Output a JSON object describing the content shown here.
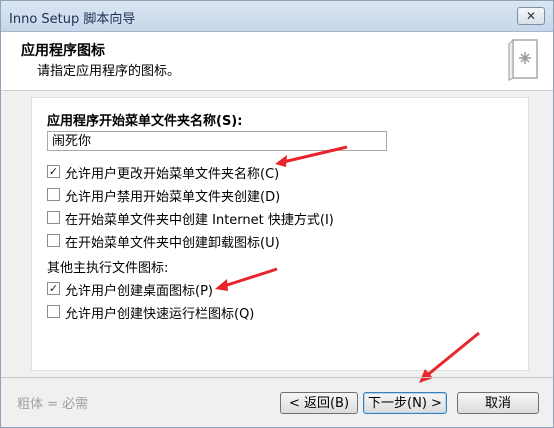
{
  "window": {
    "title": "Inno Setup 脚本向导",
    "close_glyph": "✕"
  },
  "header": {
    "title": "应用程序图标",
    "subtitle": "请指定应用程序的图标。"
  },
  "form": {
    "folder_label": "应用程序开始菜单文件夹名称(S):",
    "folder_value": "闹死你",
    "options": [
      {
        "label": "允许用户更改开始菜单文件夹名称(C)",
        "checked": true
      },
      {
        "label": "允许用户禁用开始菜单文件夹创建(D)",
        "checked": false
      },
      {
        "label": "在开始菜单文件夹中创建 Internet 快捷方式(I)",
        "checked": false
      },
      {
        "label": "在开始菜单文件夹中创建卸载图标(U)",
        "checked": false
      }
    ],
    "other_section": "其他主执行文件图标:",
    "other_options": [
      {
        "label": "允许用户创建桌面图标(P)",
        "checked": true
      },
      {
        "label": "允许用户创建快速运行栏图标(Q)",
        "checked": false
      }
    ],
    "check_glyph": "✓"
  },
  "footer": {
    "legend": "粗体 = 必需",
    "back_label": "< 返回(B)",
    "next_label": "下一步(N) >",
    "cancel_label": "取消"
  },
  "colors": {
    "annotation_arrow": "#e8252b"
  }
}
